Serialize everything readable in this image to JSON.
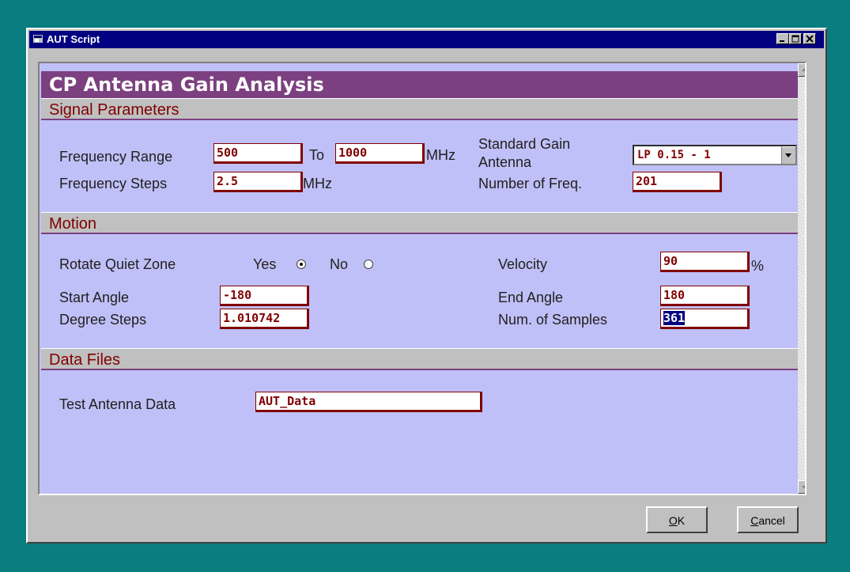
{
  "window": {
    "title": "AUT Script"
  },
  "header": {
    "title": "CP Antenna Gain Analysis"
  },
  "signal": {
    "section_title": "Signal Parameters",
    "freq_range_label": "Frequency Range",
    "freq_start": "500",
    "to_label": "To",
    "freq_end": "1000",
    "mhz_unit": "MHz",
    "std_gain_label_1": "Standard Gain",
    "std_gain_label_2": "Antenna",
    "std_gain_value": "LP 0.15 - 1",
    "freq_steps_label": "Frequency Steps",
    "freq_steps": "2.5",
    "num_freq_label": "Number of Freq.",
    "num_freq": "201"
  },
  "motion": {
    "section_title": "Motion",
    "rotate_label": "Rotate Quiet Zone",
    "yes_label": "Yes",
    "no_label": "No",
    "rotate_selected": "Yes",
    "velocity_label": "Velocity",
    "velocity": "90",
    "percent_unit": "%",
    "start_angle_label": "Start Angle",
    "start_angle": "-180",
    "end_angle_label": "End Angle",
    "end_angle": "180",
    "degree_steps_label": "Degree Steps",
    "degree_steps": "1.010742",
    "num_samples_label": "Num. of Samples",
    "num_samples": "361"
  },
  "data_files": {
    "section_title": "Data Files",
    "test_antenna_label": "Test Antenna Data",
    "test_antenna": "AUT_Data"
  },
  "buttons": {
    "ok_first": "O",
    "ok_rest": "K",
    "cancel_first": "C",
    "cancel_rest": "ancel"
  },
  "colors": {
    "desktop": "#0a7d80",
    "titlebar": "#000080",
    "header": "#7c4080",
    "panel": "#c0c0f8",
    "field_text": "#800000"
  }
}
